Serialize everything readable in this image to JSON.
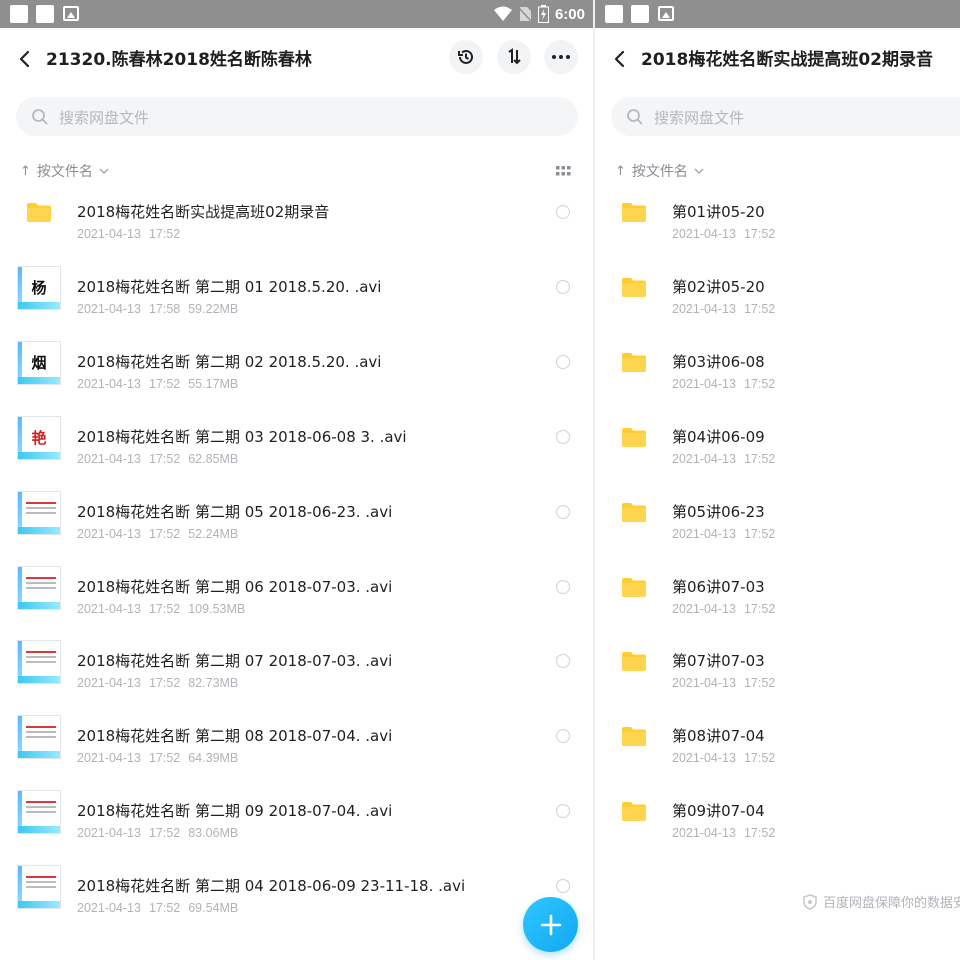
{
  "status_bar": {
    "time": "6:00"
  },
  "left": {
    "title": "21320.陈春林2018姓名断陈春林",
    "search_placeholder": "搜索网盘文件",
    "sort_label": "按文件名",
    "files": [
      {
        "name": "2018梅花姓名断实战提高班02期录音",
        "date": "2021-04-13",
        "time": "17:52",
        "size": "",
        "icon": "folder-icon"
      },
      {
        "name": "2018梅花姓名断 第二期 01  2018.5.20. .avi",
        "date": "2021-04-13",
        "time": "17:58",
        "size": "59.22MB",
        "icon": "video-thumbnail",
        "thumb_text": "杨",
        "thumb_color": "#111111"
      },
      {
        "name": "2018梅花姓名断 第二期 02  2018.5.20. .avi",
        "date": "2021-04-13",
        "time": "17:52",
        "size": "55.17MB",
        "icon": "video-thumbnail",
        "thumb_text": "烟",
        "thumb_color": "#111111"
      },
      {
        "name": "2018梅花姓名断 第二期 03 2018-06-08 3. .avi",
        "date": "2021-04-13",
        "time": "17:52",
        "size": "62.85MB",
        "icon": "video-thumbnail",
        "thumb_text": "艳",
        "thumb_color": "#d81e1e"
      },
      {
        "name": "2018梅花姓名断 第二期 05 2018-06-23. .avi",
        "date": "2021-04-13",
        "time": "17:52",
        "size": "52.24MB",
        "icon": "video-thumbnail",
        "thumb_text": "",
        "thumb_color": "#d83a3a"
      },
      {
        "name": "2018梅花姓名断 第二期 06 2018-07-03. .avi",
        "date": "2021-04-13",
        "time": "17:52",
        "size": "109.53MB",
        "icon": "video-thumbnail",
        "thumb_text": "",
        "thumb_color": "#d83a3a"
      },
      {
        "name": "2018梅花姓名断 第二期 07 2018-07-03. .avi",
        "date": "2021-04-13",
        "time": "17:52",
        "size": "82.73MB",
        "icon": "video-thumbnail",
        "thumb_text": "",
        "thumb_color": "#d83a3a"
      },
      {
        "name": "2018梅花姓名断 第二期 08  2018-07-04. .avi",
        "date": "2021-04-13",
        "time": "17:52",
        "size": "64.39MB",
        "icon": "video-thumbnail",
        "thumb_text": "",
        "thumb_color": "#d83a3a"
      },
      {
        "name": "2018梅花姓名断 第二期 09 2018-07-04. .avi",
        "date": "2021-04-13",
        "time": "17:52",
        "size": "83.06MB",
        "icon": "video-thumbnail",
        "thumb_text": "",
        "thumb_color": "#d83a3a"
      },
      {
        "name": "2018梅花姓名断 第二期 04 2018-06-09 23-11-18. .avi",
        "date": "2021-04-13",
        "time": "17:52",
        "size": "69.54MB",
        "icon": "video-thumbnail",
        "thumb_text": "",
        "thumb_color": "#d83a3a"
      }
    ]
  },
  "right": {
    "title": "2018梅花姓名断实战提高班02期录音",
    "search_placeholder": "搜索网盘文件",
    "sort_label": "按文件名",
    "files": [
      {
        "name": "第01讲05-20",
        "date": "2021-04-13",
        "time": "17:52"
      },
      {
        "name": "第02讲05-20",
        "date": "2021-04-13",
        "time": "17:52"
      },
      {
        "name": "第03讲06-08",
        "date": "2021-04-13",
        "time": "17:52"
      },
      {
        "name": "第04讲06-09",
        "date": "2021-04-13",
        "time": "17:52"
      },
      {
        "name": "第05讲06-23",
        "date": "2021-04-13",
        "time": "17:52"
      },
      {
        "name": "第06讲07-03",
        "date": "2021-04-13",
        "time": "17:52"
      },
      {
        "name": "第07讲07-03",
        "date": "2021-04-13",
        "time": "17:52"
      },
      {
        "name": "第08讲07-04",
        "date": "2021-04-13",
        "time": "17:52"
      },
      {
        "name": "第09讲07-04",
        "date": "2021-04-13",
        "time": "17:52"
      }
    ],
    "footer_note": "百度网盘保障你的数据安全"
  },
  "colors": {
    "folder": "#ffcc33",
    "accent": "#11a8f2"
  }
}
